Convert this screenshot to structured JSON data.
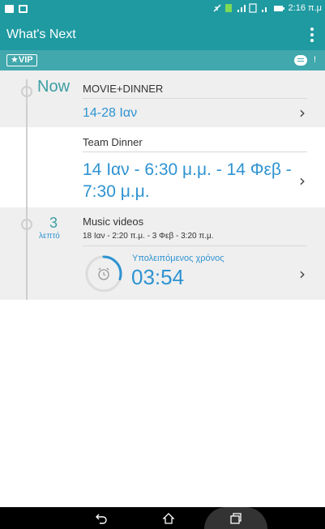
{
  "status_bar": {
    "time": "2:16 π.μ"
  },
  "app_bar": {
    "title": "What's Next"
  },
  "vip_bar": {
    "badge": "★VIP",
    "alert": "!"
  },
  "events": [
    {
      "marker": "Now",
      "title": "MOVIE+DINNER",
      "time": "14-28 Ιαν"
    },
    {
      "title": "Team Dinner",
      "time": "14 Ιαν - 6:30 μ.μ. - 14 Φεβ - 7:30 μ.μ."
    },
    {
      "marker_number": "3",
      "marker_unit": "λεπτό",
      "title": "Music videos",
      "subtitle": "18 Ιαν - 2:20 π.μ. - 3 Φεβ - 3:20 π.μ.",
      "timer_label": "Υπολειπόμενος χρόνος",
      "timer_value": "03:54",
      "timer_progress": 0.3
    }
  ],
  "colors": {
    "primary": "#1f9aa1",
    "secondary": "#41a8ad",
    "accent": "#2e93d1",
    "marker": "#3d9ea3"
  }
}
